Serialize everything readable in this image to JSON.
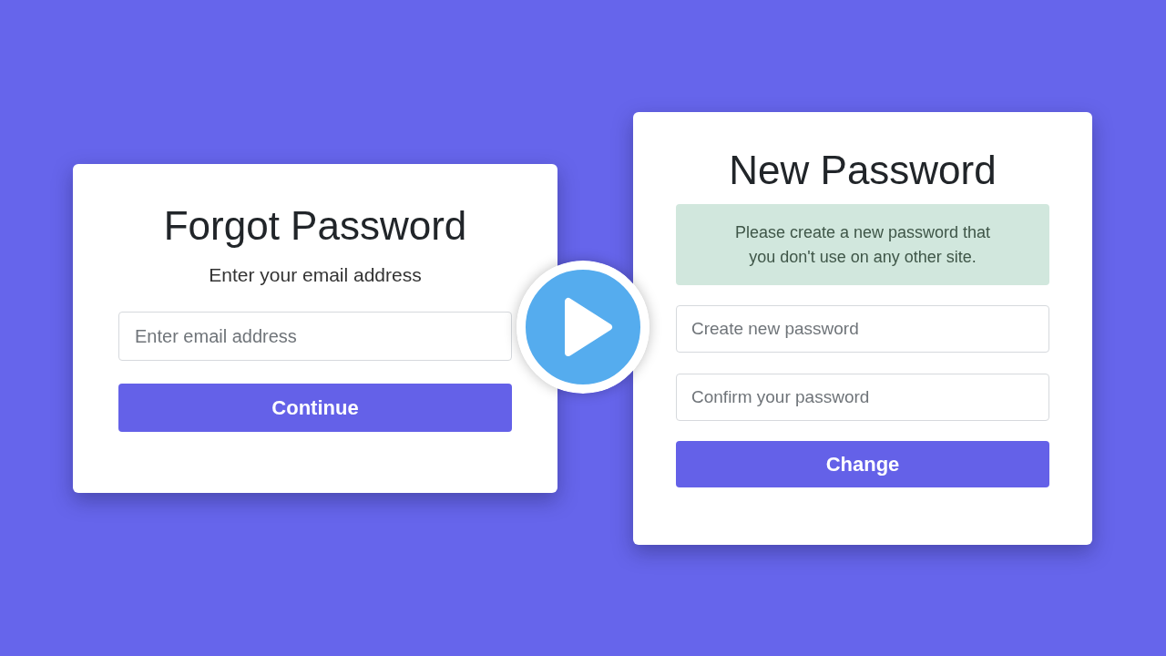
{
  "cards": [
    {
      "title": "Forgot Password",
      "subtitle": "Enter your email address",
      "fields": [
        {
          "placeholder": "Enter email address"
        }
      ],
      "button": {
        "label": "Continue"
      }
    },
    {
      "title": "New Password",
      "notice": "Please create a new password that you don't use on any other site.",
      "fields": [
        {
          "placeholder": "Create new password"
        },
        {
          "placeholder": "Confirm your password"
        }
      ],
      "button": {
        "label": "Change"
      }
    }
  ]
}
